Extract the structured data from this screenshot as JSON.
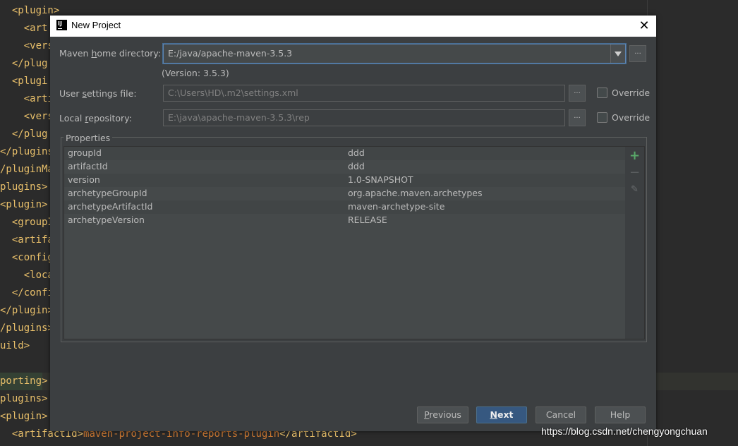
{
  "editor": {
    "lines": [
      {
        "indent": "  ",
        "tag": "<plugin>",
        "value": ""
      },
      {
        "indent": "    ",
        "tag": "<art",
        "value": ""
      },
      {
        "indent": "    ",
        "tag": "<vers",
        "value": ""
      },
      {
        "indent": "  ",
        "tag": "</plug",
        "value": ""
      },
      {
        "indent": "  ",
        "tag": "<plugi",
        "value": ""
      },
      {
        "indent": "    ",
        "tag": "<arti",
        "value": ""
      },
      {
        "indent": "    ",
        "tag": "<vers",
        "value": ""
      },
      {
        "indent": "  ",
        "tag": "</plug",
        "value": ""
      },
      {
        "indent": "",
        "tag": "</plugins",
        "value": ""
      },
      {
        "indent": "",
        "tag": "/pluginMan",
        "value": ""
      },
      {
        "indent": "",
        "tag": "plugins>",
        "value": ""
      },
      {
        "indent": "",
        "tag": "<plugin>",
        "value": ""
      },
      {
        "indent": "  ",
        "tag": "<groupI",
        "value": ""
      },
      {
        "indent": "  ",
        "tag": "<artifa",
        "value": ""
      },
      {
        "indent": "  ",
        "tag": "<config",
        "value": ""
      },
      {
        "indent": "    ",
        "tag": "<loca",
        "value": ""
      },
      {
        "indent": "  ",
        "tag": "</confi",
        "value": ""
      },
      {
        "indent": "",
        "tag": "</plugin>",
        "value": ""
      },
      {
        "indent": "",
        "tag": "/plugins>",
        "value": ""
      },
      {
        "indent": "",
        "tag": "uild>",
        "value": ""
      },
      {
        "indent": "",
        "tag": "",
        "value": ""
      },
      {
        "indent": "",
        "tag": "porting>",
        "value": ""
      },
      {
        "indent": "",
        "tag": "plugins>",
        "value": ""
      },
      {
        "indent": "",
        "tag": "<plugin>",
        "value": ""
      },
      {
        "indent": "  ",
        "tag": "<artifactId>",
        "value": "maven-project-info-reports-plugin",
        "close": "</artifactId>"
      }
    ]
  },
  "dialog": {
    "title": "New Project",
    "close_symbol": "✕",
    "maven_home": {
      "label_pre": "Maven ",
      "label_u": "h",
      "label_post": "ome directory:",
      "value": "E:/java/apache-maven-3.5.3",
      "version": "(Version: 3.5.3)"
    },
    "user_settings": {
      "label_pre": "User ",
      "label_u": "s",
      "label_post": "ettings file:",
      "value": "C:\\Users\\HD\\.m2\\settings.xml",
      "override": "Override"
    },
    "local_repo": {
      "label_pre": "Local ",
      "label_u": "r",
      "label_post": "epository:",
      "value": "E:\\java\\apache-maven-3.5.3\\rep",
      "override": "Override"
    },
    "browse_label": "...",
    "properties": {
      "legend": "Properties",
      "rows": [
        {
          "key": "groupId",
          "value": "ddd"
        },
        {
          "key": "artifactId",
          "value": "ddd"
        },
        {
          "key": "version",
          "value": "1.0-SNAPSHOT"
        },
        {
          "key": "archetypeGroupId",
          "value": "org.apache.maven.archetypes"
        },
        {
          "key": "archetypeArtifactId",
          "value": "maven-archetype-site"
        },
        {
          "key": "archetypeVersion",
          "value": "RELEASE"
        }
      ],
      "tools": {
        "add": "+",
        "remove": "−",
        "edit": "✎"
      }
    },
    "buttons": {
      "previous_u": "P",
      "previous_rest": "revious",
      "next_u": "N",
      "next_rest": "ext",
      "cancel": "Cancel",
      "help": "Help"
    }
  },
  "watermark": "https://blog.csdn.net/chengyongchuan",
  "colors": {
    "accent": "#365880",
    "focus": "#5e84b0",
    "add_icon": "#59a869"
  }
}
